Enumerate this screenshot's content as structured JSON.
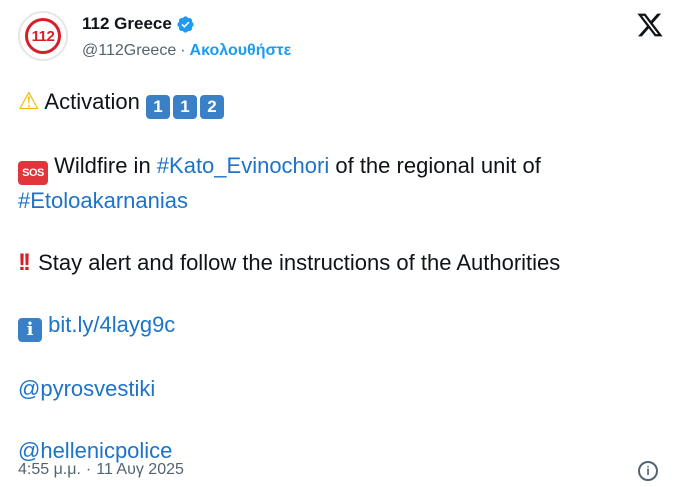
{
  "author": {
    "avatar_text": "112",
    "display_name": "112 Greece",
    "handle": "@112Greece",
    "separator": "·",
    "follow_label": "Ακολουθήστε"
  },
  "tweet": {
    "line1_text": "Activation",
    "line1_keys": [
      "1",
      "1",
      "2"
    ],
    "sos_label": "SOS",
    "line2_pre": " Wildfire in ",
    "line2_tag": "#Kato_Evinochori",
    "line2_post": " of the regional unit of",
    "line3_tag": "#Etoloakarnanias",
    "line4_text": " Stay alert and follow the instructions of the Authorities",
    "info_glyph": "i",
    "link_text": "bit.ly/4layg9c",
    "mention1": "@pyrosvestiki",
    "mention2": "@hellenicpolice"
  },
  "footer": {
    "time": "4:55 μ.μ.",
    "separator": "·",
    "date": "11 Αυγ 2025"
  },
  "colors": {
    "link": "#1d73c9",
    "follow": "#1d9bf0",
    "verified": "#1d9bf0",
    "brand_red": "#d61f26"
  }
}
